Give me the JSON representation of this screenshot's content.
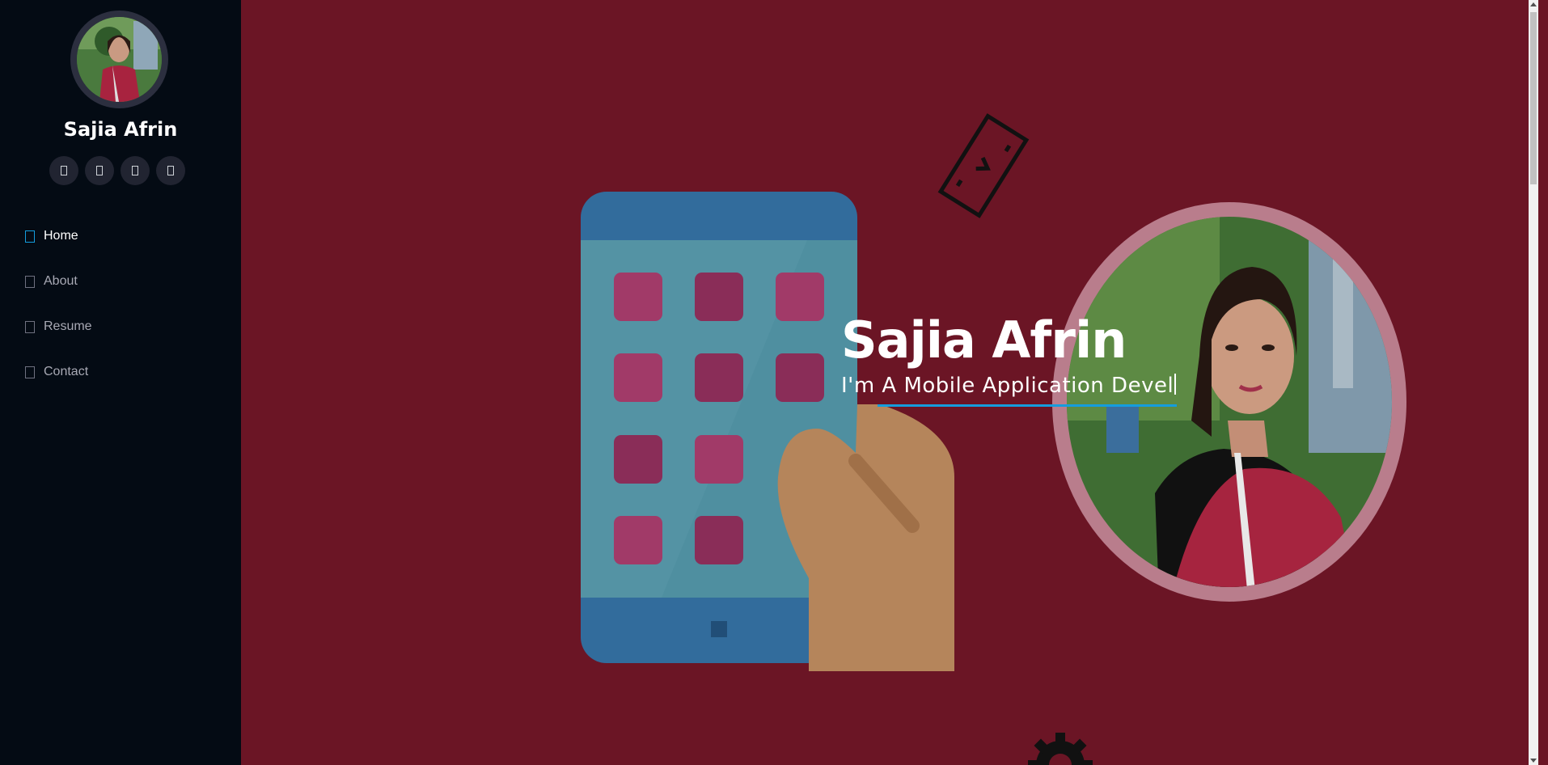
{
  "profile": {
    "name": "Sajia Afrin"
  },
  "socials": [
    {
      "icon": "twitter-icon"
    },
    {
      "icon": "facebook-icon"
    },
    {
      "icon": "instagram-icon"
    },
    {
      "icon": "linkedin-icon"
    }
  ],
  "nav": {
    "items": [
      {
        "label": "Home",
        "icon": "home-icon",
        "active": true
      },
      {
        "label": "About",
        "icon": "person-icon",
        "active": false
      },
      {
        "label": "Resume",
        "icon": "file-icon",
        "active": false
      },
      {
        "label": "Contact",
        "icon": "envelope-icon",
        "active": false
      }
    ]
  },
  "hero": {
    "title": "Sajia Afrin",
    "typed_text": "I'm A Mobile Application Devel"
  },
  "colors": {
    "sidebar_bg": "#040b14",
    "hero_bg": "#6b1525",
    "accent": "#149ddd"
  }
}
